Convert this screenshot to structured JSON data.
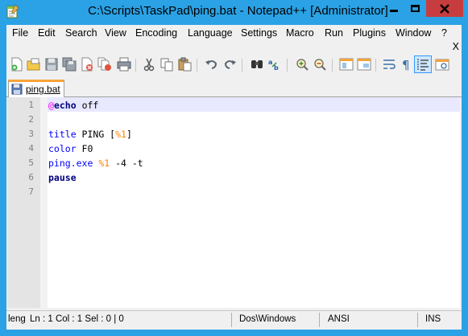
{
  "window": {
    "title": "C:\\Scripts\\TaskPad\\ping.bat - Notepad++ [Administrator]",
    "accent_color": "#2aa2e5",
    "close_button_color": "#c73d3f"
  },
  "menu": {
    "items": [
      "File",
      "Edit",
      "Search",
      "View",
      "Encoding",
      "Language",
      "Settings",
      "Macro",
      "Run",
      "Plugins",
      "Window",
      "?"
    ],
    "close_doc": "X"
  },
  "toolbar": {
    "icons": [
      "new-file-icon",
      "open-file-icon",
      "save-icon",
      "save-all-icon",
      "close-icon",
      "close-all-icon",
      "print-icon",
      "cut-icon",
      "copy-icon",
      "paste-icon",
      "undo-icon",
      "redo-icon",
      "find-icon",
      "replace-icon",
      "zoom-in-icon",
      "zoom-out-icon",
      "sync-vertical-icon",
      "sync-horizontal-icon",
      "word-wrap-icon",
      "show-all-chars-icon",
      "indent-guide-icon",
      "document-map-icon"
    ],
    "active": "indent-guide-icon"
  },
  "tabs": [
    {
      "label": "ping.bat",
      "active": true
    }
  ],
  "editor": {
    "line_numbers": [
      "1",
      "2",
      "3",
      "4",
      "5",
      "6",
      "7"
    ],
    "lines": [
      {
        "at": "@",
        "kw": "echo",
        "rest": " off"
      },
      {},
      {
        "kw": "title",
        "rest": " PING ",
        "open": "[",
        "var": "%1",
        "close": "]"
      },
      {
        "kw": "color",
        "rest": " F0"
      },
      {
        "kw": "ping.exe",
        "sp": " ",
        "var": "%1",
        "rest": " -4 -t"
      },
      {
        "kw": "pause"
      },
      {}
    ],
    "current_line": 1
  },
  "status": {
    "length": "leng",
    "position": "Ln : 1    Col : 1    Sel : 0 | 0",
    "eol": "Dos\\Windows",
    "encoding": "ANSI",
    "mode": "INS"
  }
}
